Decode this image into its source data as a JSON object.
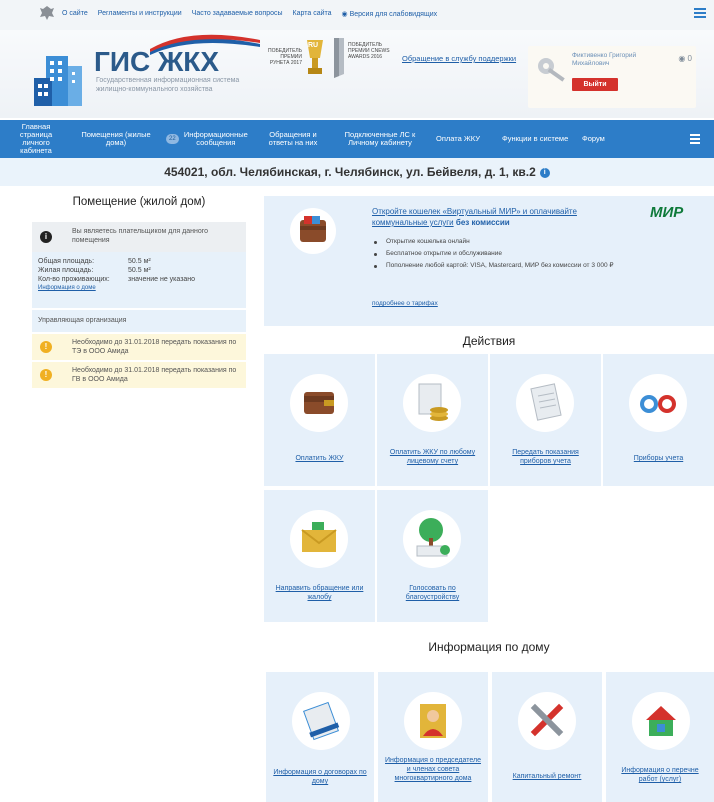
{
  "topbar": {
    "links": [
      "О сайте",
      "Регламенты и инструкции",
      "Часто задаваемые вопросы",
      "Карта сайта",
      "Версия для слабовидящих"
    ]
  },
  "header": {
    "logo_title": "ГИС ЖКХ",
    "logo_subtitle": "Государственная информационная система жилищно-коммунального хозяйства",
    "award1": "Победитель премии Рунета 2017",
    "award2": "Победитель премии CNEWS AWARDS 2016",
    "award_badge": "RU",
    "support_link": "Обращение в службу поддержки",
    "user_name": "Фиктивенко Григорий Михайлович",
    "logout": "Выйти",
    "user_badges": "◉ 0"
  },
  "nav": {
    "items": [
      {
        "label": "Главная страница личного кабинета"
      },
      {
        "label": "Помещения (жилые дома)"
      },
      {
        "label": "Информационные сообщения",
        "badge": "22"
      },
      {
        "label": "Обращения и ответы на них"
      },
      {
        "label": "Подключенные ЛС к Личному кабинету"
      },
      {
        "label": "Оплата ЖКУ"
      },
      {
        "label": "Функции в системе"
      },
      {
        "label": "Форум"
      }
    ]
  },
  "address": "454021, обл. Челябинская, г. Челябинск, ул. Бейвеля, д. 1, кв.2",
  "left": {
    "title": "Помещение (жилой дом)",
    "notice": "Вы являетесь плательщиком для данного помещения",
    "stats": [
      {
        "k": "Общая площадь:",
        "v": "50.5 м²"
      },
      {
        "k": "Жилая площадь:",
        "v": "50.5 м²"
      },
      {
        "k": "Кол-во проживающих:",
        "v": "значение не указано"
      }
    ],
    "house_info_link": "Информация о доме",
    "mgmt": "Управляющая организация",
    "warnings": [
      "Необходимо до 31.01.2018 передать показания по ТЭ в ООО Амида",
      "Необходимо до 31.01.2018 передать показания по ГВ в ООО Амида"
    ]
  },
  "promo": {
    "title": "Откройте кошелек «Виртуальный МИР» и оплачивайте коммунальные услуги",
    "title_bold": "без комиссии",
    "logo": "МИР",
    "items": [
      "Открытие кошелька онлайн",
      "Бесплатное открытие и обслуживание",
      "Пополнение любой картой: VISA, Mastercard, МИР без комиссии от 3 000 ₽"
    ],
    "more": "подробнее о тарифах"
  },
  "actions": {
    "title": "Действия",
    "tiles": [
      "Оплатить ЖКУ",
      "Оплатить ЖКУ по любому лицевому счету",
      "Передать показания приборов учета",
      "Приборы учета",
      "Направить обращение или жалобу",
      "Голосовать по благоустройству"
    ]
  },
  "house": {
    "title": "Информация по дому",
    "tiles": [
      "Информация о договорах по дому",
      "Информация о председателе и членах совета многоквартирного дома",
      "Капитальный ремонт",
      "Информация о перечне работ (услуг)"
    ]
  }
}
